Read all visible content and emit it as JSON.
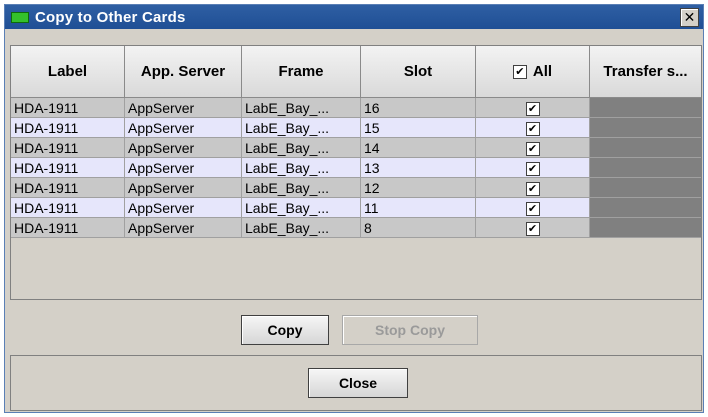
{
  "window": {
    "title": "Copy to Other Cards",
    "close_glyph": "✕"
  },
  "table": {
    "headers": [
      "Label",
      "App. Server",
      "Frame",
      "Slot",
      "All",
      "Transfer s..."
    ],
    "all_checked": true,
    "rows": [
      {
        "label": "HDA-1911",
        "server": "AppServer",
        "frame": "LabE_Bay_...",
        "slot": "16",
        "checked": true
      },
      {
        "label": "HDA-1911",
        "server": "AppServer",
        "frame": "LabE_Bay_...",
        "slot": "15",
        "checked": true
      },
      {
        "label": "HDA-1911",
        "server": "AppServer",
        "frame": "LabE_Bay_...",
        "slot": "14",
        "checked": true
      },
      {
        "label": "HDA-1911",
        "server": "AppServer",
        "frame": "LabE_Bay_...",
        "slot": "13",
        "checked": true
      },
      {
        "label": "HDA-1911",
        "server": "AppServer",
        "frame": "LabE_Bay_...",
        "slot": "12",
        "checked": true
      },
      {
        "label": "HDA-1911",
        "server": "AppServer",
        "frame": "LabE_Bay_...",
        "slot": "11",
        "checked": true
      },
      {
        "label": "HDA-1911",
        "server": "AppServer",
        "frame": "LabE_Bay_...",
        "slot": "8",
        "checked": true
      }
    ]
  },
  "buttons": {
    "copy": "Copy",
    "stop_copy": "Stop Copy",
    "close": "Close"
  },
  "colors": {
    "title_bg": "#1f4f95",
    "title_icon": "#34c12c",
    "row_odd": "#c8c8c8",
    "row_even": "#e6e6fb",
    "transfer_cell": "#808080"
  }
}
